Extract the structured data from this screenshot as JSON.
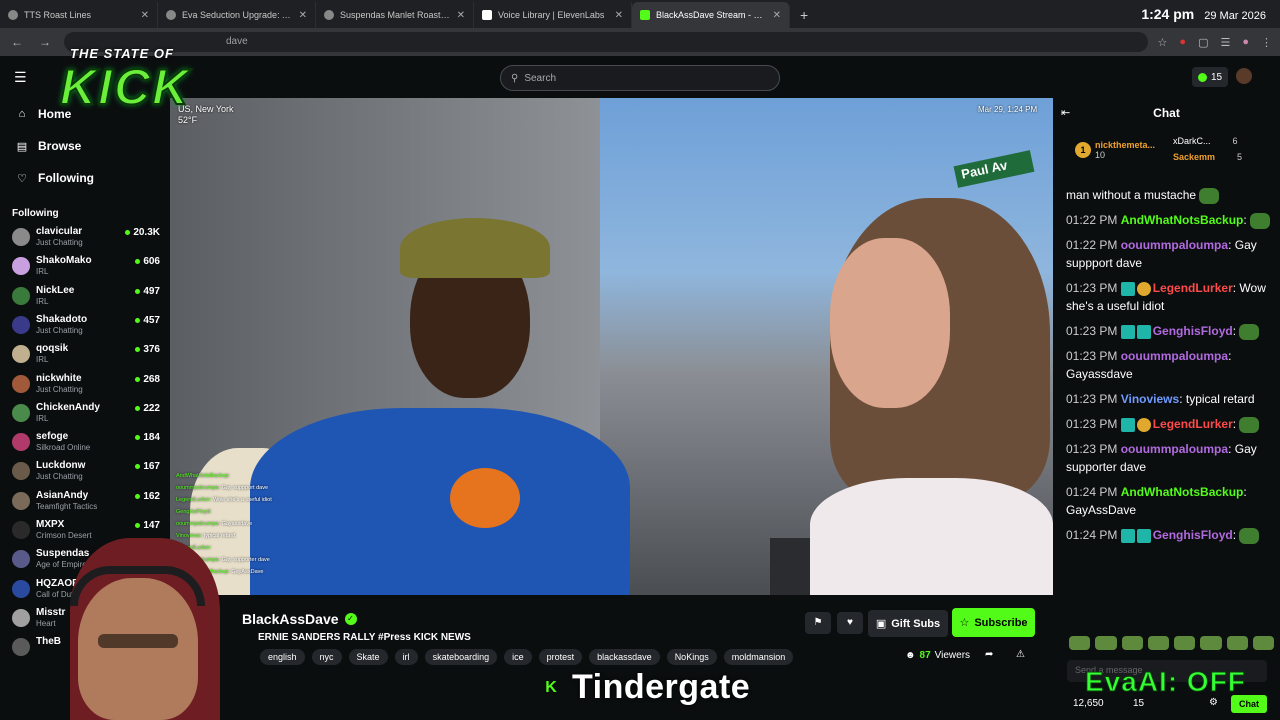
{
  "browser": {
    "tabs": [
      {
        "title": "TTS Roast Lines",
        "active": false
      },
      {
        "title": "Eva Seduction Upgrade: Archet",
        "active": false
      },
      {
        "title": "Suspendas Manlet Roasts & TT",
        "active": false
      },
      {
        "title": "Voice Library | ElevenLabs",
        "active": false
      },
      {
        "title": "BlackAssDave Stream - Wat",
        "active": true
      }
    ],
    "new_tab": "+",
    "clock_time": "1:24 pm",
    "clock_date": "29 Mar 2026",
    "url": "dave"
  },
  "logo": {
    "line1": "THE STATE OF",
    "line2": "KICK"
  },
  "kick": {
    "search_placeholder": "Search",
    "coins": "15"
  },
  "sidebar": {
    "nav": [
      {
        "label": "Home",
        "icon": "home-icon"
      },
      {
        "label": "Browse",
        "icon": "browse-icon"
      },
      {
        "label": "Following",
        "icon": "heart-icon"
      }
    ],
    "following_header": "Following",
    "following": [
      {
        "name": "clavicular",
        "category": "Just Chatting",
        "viewers": "20.3K",
        "color": "#8a8a8a"
      },
      {
        "name": "ShakoMako",
        "category": "IRL",
        "viewers": "606",
        "color": "#c8a0e0"
      },
      {
        "name": "NickLee",
        "category": "IRL",
        "viewers": "497",
        "color": "#3a7a3a"
      },
      {
        "name": "Shakadoto",
        "category": "Just Chatting",
        "viewers": "457",
        "color": "#3a3a8a"
      },
      {
        "name": "qoqsik",
        "category": "IRL",
        "viewers": "376",
        "color": "#c0b090"
      },
      {
        "name": "nickwhite",
        "category": "Just Chatting",
        "viewers": "268",
        "color": "#a05a3a"
      },
      {
        "name": "ChickenAndy",
        "category": "IRL",
        "viewers": "222",
        "color": "#4a8a4a"
      },
      {
        "name": "sefoge",
        "category": "Silkroad Online",
        "viewers": "184",
        "color": "#b03a6a"
      },
      {
        "name": "Luckdonw",
        "category": "Just Chatting",
        "viewers": "167",
        "color": "#6a5a4a"
      },
      {
        "name": "AsianAndy",
        "category": "Teamfight Tactics",
        "viewers": "162",
        "color": "#7a6a5a"
      },
      {
        "name": "MXPX",
        "category": "Crimson Desert",
        "viewers": "147",
        "color": "#2a2a2a"
      },
      {
        "name": "Suspendas",
        "category": "Age of Empires II",
        "viewers": "",
        "color": "#5a5a8a"
      },
      {
        "name": "HQZAOFPS",
        "category": "Call of Duty: W",
        "viewers": "",
        "color": "#2a4aa0"
      },
      {
        "name": "Misstr",
        "category": "Heart",
        "viewers": "",
        "color": "#a0a0a0"
      },
      {
        "name": "TheB",
        "category": "",
        "viewers": "",
        "color": "#5a5a5a"
      }
    ]
  },
  "video": {
    "location": "US, New York",
    "temp": "52°F",
    "timestamp": "Mar 29, 1:24 PM",
    "street_sign": "Paul Av",
    "overlay_chat": [
      {
        "user": "AndWhatNotsBackup:",
        "text": ""
      },
      {
        "user": "ooummpaloumpa:",
        "text": "Gay suppport dave"
      },
      {
        "user": "LegendLurker:",
        "text": "Wow she's a useful idiot"
      },
      {
        "user": "GenghisFloyd:",
        "text": ""
      },
      {
        "user": "ooummpaloumpa:",
        "text": "Gayassdave"
      },
      {
        "user": "Vinoviews:",
        "text": "typical retard"
      },
      {
        "user": "LegendLurker:",
        "text": ""
      },
      {
        "user": "ooummpaloumpa:",
        "text": "Gay supporter dave"
      },
      {
        "user": "AndWhatNotsBackup:",
        "text": "GayAssDave"
      },
      {
        "user": "GenghisFloyd:",
        "text": ""
      }
    ]
  },
  "stream": {
    "streamer": "BlackAssDave",
    "title": "ERNIE SANDERS RALLY #Press KICK NEWS",
    "tags": [
      "english",
      "nyc",
      "Skate",
      "irl",
      "skateboarding",
      "ice",
      "protest",
      "blackassdave",
      "NoKings",
      "moldmansion"
    ],
    "gift_label": "Gift Subs",
    "subscribe_label": "Subscribe",
    "viewers_count": "87",
    "viewers_label": "Viewers"
  },
  "caption": {
    "text": "Tindergate",
    "k": "K"
  },
  "chat": {
    "header": "Chat",
    "leaderboard": [
      {
        "rank": "1",
        "name": "nickthemeta...",
        "count": "10"
      },
      {
        "name": "xDarkC...",
        "count": "6"
      },
      {
        "name": "Sackemm",
        "count": "5"
      }
    ],
    "messages": [
      {
        "ts": "",
        "user": "",
        "user_class": "",
        "text": "man without a mustache",
        "badges": [],
        "emote": true
      },
      {
        "ts": "01:22 PM",
        "user": "AndWhatNotsBackup",
        "user_class": "u-green",
        "text": "",
        "badges": [],
        "emote": true
      },
      {
        "ts": "01:22 PM",
        "user": "oouummpaloumpa",
        "user_class": "u-purple",
        "text": "Gay suppport dave",
        "badges": [],
        "emote": false
      },
      {
        "ts": "01:23 PM",
        "user": "LegendLurker",
        "user_class": "u-red",
        "text": "Wow she's a useful idiot",
        "badges": [
          "sub",
          "gold"
        ],
        "emote": false
      },
      {
        "ts": "01:23 PM",
        "user": "GenghisFloyd",
        "user_class": "u-purple",
        "text": "",
        "badges": [
          "sub",
          "sub"
        ],
        "emote": true
      },
      {
        "ts": "01:23 PM",
        "user": "oouummpaloumpa",
        "user_class": "u-purple",
        "text": "Gayassdave",
        "badges": [],
        "emote": false
      },
      {
        "ts": "01:23 PM",
        "user": "Vinoviews",
        "user_class": "u-blue",
        "text": "typical retard",
        "badges": [],
        "emote": false
      },
      {
        "ts": "01:23 PM",
        "user": "LegendLurker",
        "user_class": "u-red",
        "text": "",
        "badges": [
          "sub",
          "gold"
        ],
        "emote": true
      },
      {
        "ts": "01:23 PM",
        "user": "oouummpaloumpa",
        "user_class": "u-purple",
        "text": "Gay supporter dave",
        "badges": [],
        "emote": false
      },
      {
        "ts": "01:24 PM",
        "user": "AndWhatNotsBackup",
        "user_class": "u-green",
        "text": "GayAssDave",
        "badges": [],
        "emote": false
      },
      {
        "ts": "01:24 PM",
        "user": "GenghisFloyd",
        "user_class": "u-purple",
        "text": "",
        "badges": [
          "sub",
          "sub"
        ],
        "emote": true
      }
    ],
    "input_placeholder": "Send a message",
    "points": "12,650",
    "subs": "15",
    "chat_button": "Chat"
  },
  "overlay": {
    "evai": "EvaAI: OFF"
  },
  "colors": {
    "accent": "#53fc18",
    "bg": "#0b0e0f"
  }
}
